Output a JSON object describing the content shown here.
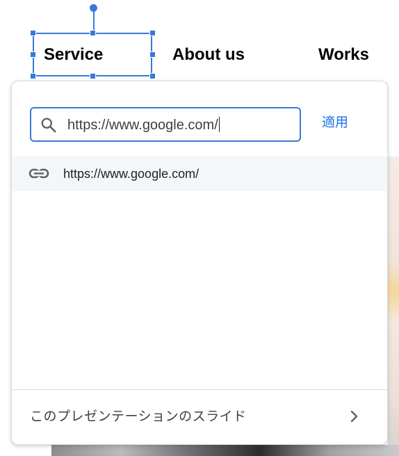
{
  "nav": {
    "items": [
      "Service",
      "About us",
      "Works"
    ]
  },
  "link_popup": {
    "url_input_value": "https://www.google.com/",
    "apply_label": "適用",
    "suggestion_url": "https://www.google.com/",
    "slides_option_label": "このプレゼンテーションのスライド"
  },
  "icons": {
    "search": "search-icon",
    "link": "link-icon",
    "chevron": "chevron-right-icon"
  },
  "colors": {
    "accent": "#3a78d8",
    "apply_text": "#1a73e8",
    "suggestion_bg": "#f5f6f8"
  }
}
